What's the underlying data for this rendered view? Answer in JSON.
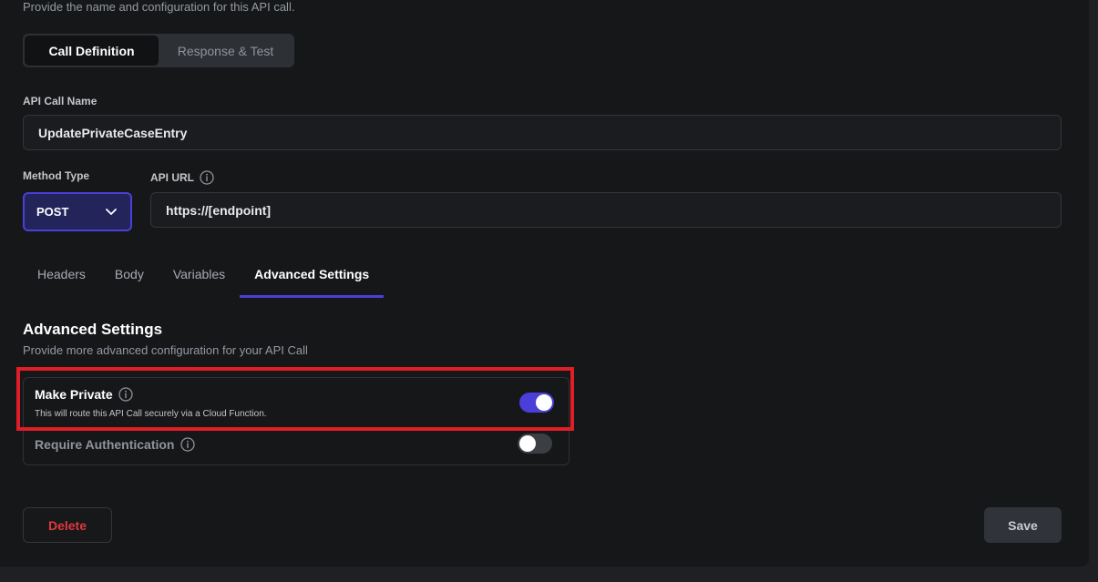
{
  "header": {
    "subtitle": "Provide the name and configuration for this API call."
  },
  "segmented": {
    "call_definition": "Call Definition",
    "response_test": "Response & Test"
  },
  "fields": {
    "api_call_name_label": "API Call Name",
    "api_call_name_value": "UpdatePrivateCaseEntry",
    "method_type_label": "Method Type",
    "method_type_value": "POST",
    "api_url_label": "API URL",
    "api_url_value": "https://[endpoint]"
  },
  "tabs": [
    {
      "label": "Headers"
    },
    {
      "label": "Body"
    },
    {
      "label": "Variables"
    },
    {
      "label": "Advanced Settings"
    }
  ],
  "advanced": {
    "title": "Advanced Settings",
    "subtitle": "Provide more advanced configuration for your API Call",
    "make_private": {
      "title": "Make Private",
      "description": "This will route this API Call securely via a Cloud Function.",
      "enabled": true
    },
    "require_auth": {
      "title": "Require Authentication",
      "enabled": false
    }
  },
  "footer": {
    "delete_label": "Delete",
    "save_label": "Save"
  },
  "colors": {
    "accent": "#4b3fd9",
    "danger": "#e0393e",
    "highlight": "#e01e27"
  }
}
